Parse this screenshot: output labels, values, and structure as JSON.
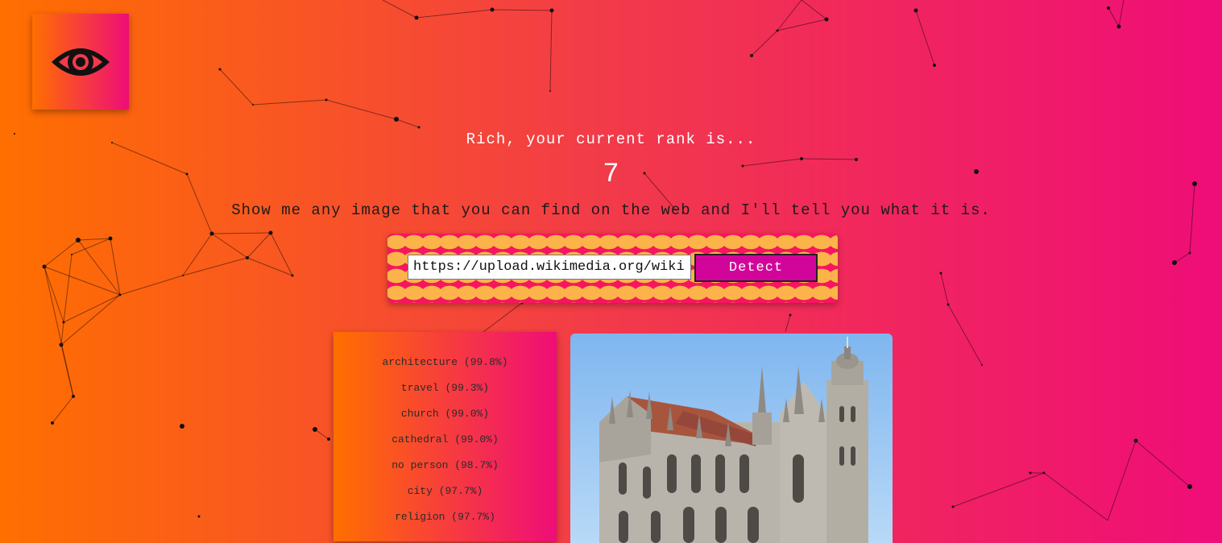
{
  "header": {
    "logo_icon": "eye-icon"
  },
  "rank": {
    "message": "Rich, your current rank is...",
    "value": "7"
  },
  "instructions": "Show me any image that you can find on the web and I'll tell you what it is.",
  "form": {
    "url_value": "https://upload.wikimedia.org/wikipedia",
    "detect_label": "Detect"
  },
  "results": {
    "tags": [
      "architecture (99.8%)",
      "travel (99.3%)",
      "church (99.0%)",
      "cathedral (99.0%)",
      "no person (98.7%)",
      "city (97.7%)",
      "religion (97.7%)"
    ]
  },
  "colors": {
    "gradient_start": "#ff6f00",
    "gradient_end": "#ef0d78",
    "button": "#d2059a",
    "pattern_dot": "#fbb34a",
    "pattern_bg": "#f7155f",
    "sky": "#8ec3f3"
  },
  "image": {
    "subject": "cathedral-photo"
  }
}
